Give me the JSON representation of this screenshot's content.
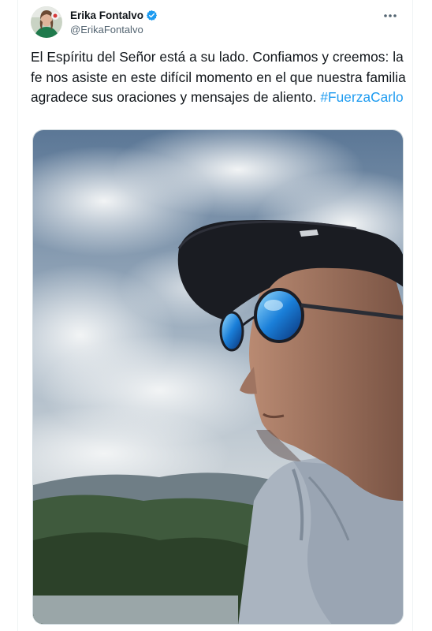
{
  "tweet": {
    "author": {
      "display_name": "Erika Fontalvo",
      "handle": "@ErikaFontalvo",
      "verified": true
    },
    "text": "El Espíritu del Señor está a su lado. Confiamos y creemos: la fe nos asiste en este difícil momento en el que nuestra familia agradece sus oraciones y mensajes de aliento.",
    "hashtag": "#FuerzaCarlo",
    "media": {
      "type": "photo"
    }
  },
  "icons": {
    "verified": "verified-badge-icon",
    "more": "more-options-icon"
  },
  "colors": {
    "link": "#1d9bf0",
    "text": "#0f1419",
    "secondary": "#536471",
    "border": "#cfd9de"
  }
}
